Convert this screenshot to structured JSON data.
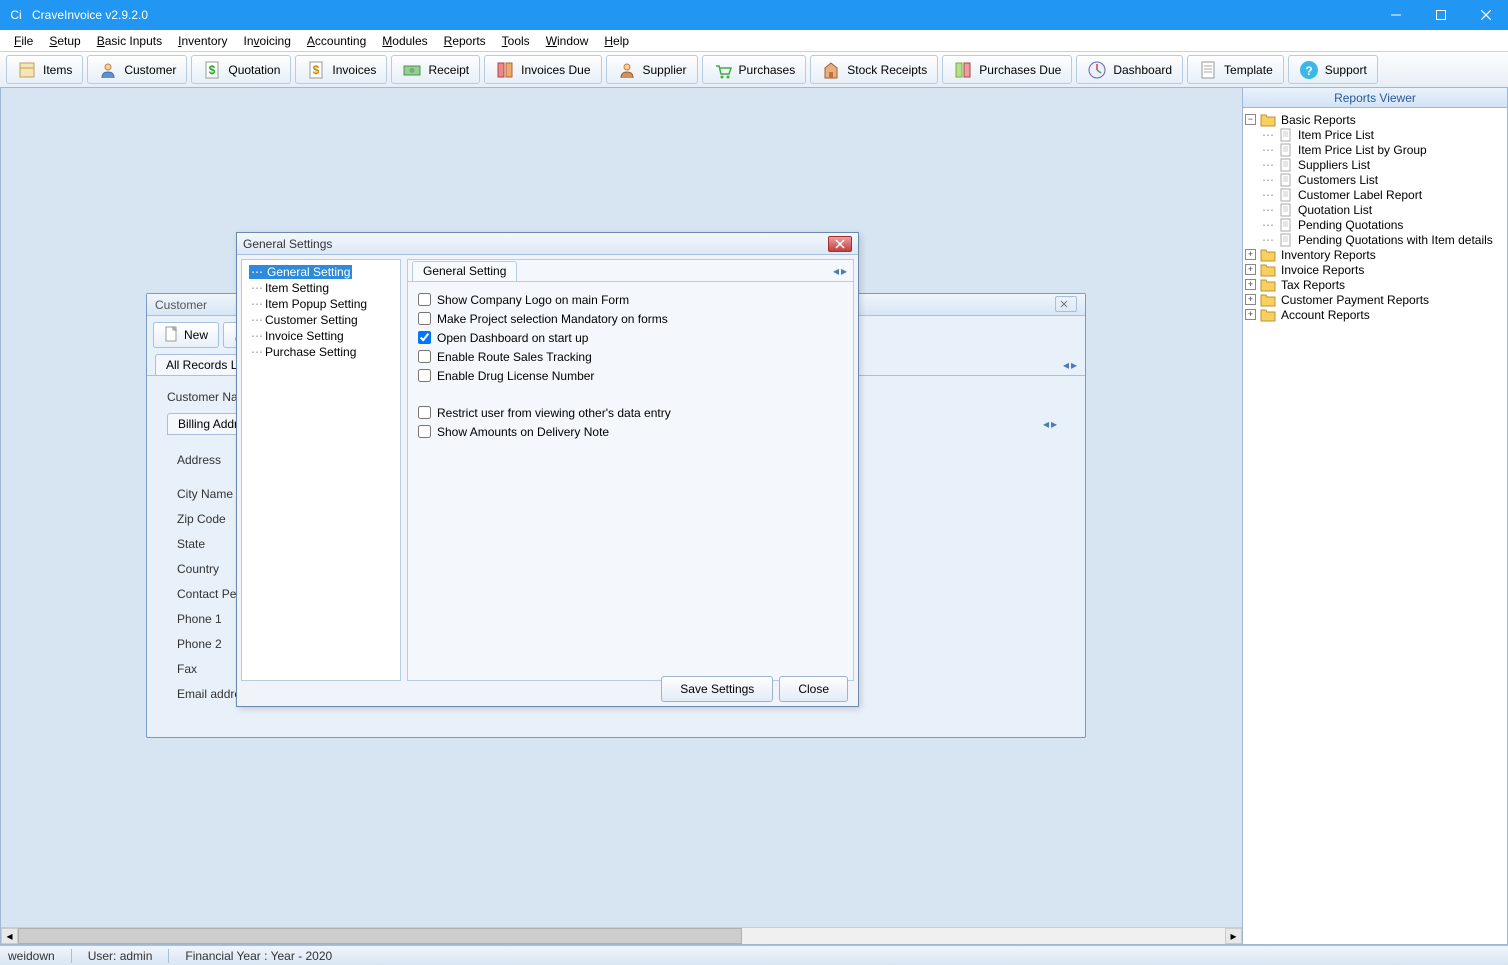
{
  "app": {
    "title": "CraveInvoice v2.9.2.0",
    "icon_label": "Ci"
  },
  "menu": [
    "File",
    "Setup",
    "Basic Inputs",
    "Inventory",
    "Invoicing",
    "Accounting",
    "Modules",
    "Reports",
    "Tools",
    "Window",
    "Help"
  ],
  "toolbar": [
    {
      "label": "Items",
      "icon": "items-icon"
    },
    {
      "label": "Customer",
      "icon": "customer-icon"
    },
    {
      "label": "Quotation",
      "icon": "quotation-icon"
    },
    {
      "label": "Invoices",
      "icon": "invoices-icon"
    },
    {
      "label": "Receipt",
      "icon": "receipt-icon"
    },
    {
      "label": "Invoices Due",
      "icon": "invoices-due-icon"
    },
    {
      "label": "Supplier",
      "icon": "supplier-icon"
    },
    {
      "label": "Purchases",
      "icon": "purchases-icon"
    },
    {
      "label": "Stock Receipts",
      "icon": "stock-receipts-icon"
    },
    {
      "label": "Purchases Due",
      "icon": "purchases-due-icon"
    },
    {
      "label": "Dashboard",
      "icon": "dashboard-icon"
    },
    {
      "label": "Template",
      "icon": "template-icon"
    },
    {
      "label": "Support",
      "icon": "support-icon"
    }
  ],
  "reports": {
    "title": "Reports Viewer",
    "basic_label": "Basic Reports",
    "basic_items": [
      "Item Price List",
      "Item Price List by Group",
      "Suppliers List",
      "Customers List",
      "Customer Label Report",
      "Quotation List",
      "Pending Quotations",
      "Pending Quotations with Item details"
    ],
    "folders": [
      "Inventory Reports",
      "Invoice Reports",
      "Tax Reports",
      "Customer Payment Reports",
      "Account Reports"
    ]
  },
  "customer": {
    "title": "Customer",
    "new_btn": "New",
    "tab_all": "All Records List",
    "field_customer_name": "Customer Nam",
    "subtab_billing": "Billing Address",
    "fields": [
      "Address",
      "City Name",
      "Zip Code",
      "State",
      "Country",
      "Contact Pers",
      "Phone 1",
      "Phone 2",
      "Fax",
      "Email addres"
    ]
  },
  "settings": {
    "title": "General Settings",
    "tree": [
      "General Setting",
      "Item Setting",
      "Item Popup Setting",
      "Customer Setting",
      "Invoice Setting",
      "Purchase Setting"
    ],
    "right_tab": "General Setting",
    "options_a": [
      {
        "label": "Show Company Logo on main Form",
        "checked": false
      },
      {
        "label": "Make Project selection Mandatory on forms",
        "checked": false
      },
      {
        "label": "Open Dashboard on start up",
        "checked": true
      },
      {
        "label": "Enable Route Sales Tracking",
        "checked": false
      },
      {
        "label": "Enable Drug License Number",
        "checked": false
      }
    ],
    "options_b": [
      {
        "label": "Restrict user from viewing other's data entry",
        "checked": false
      },
      {
        "label": "Show Amounts on Delivery Note",
        "checked": false
      }
    ],
    "save_btn": "Save Settings",
    "close_btn": "Close"
  },
  "status": {
    "company": "weidown",
    "user": "User: admin",
    "year": "Financial Year : Year - 2020"
  }
}
